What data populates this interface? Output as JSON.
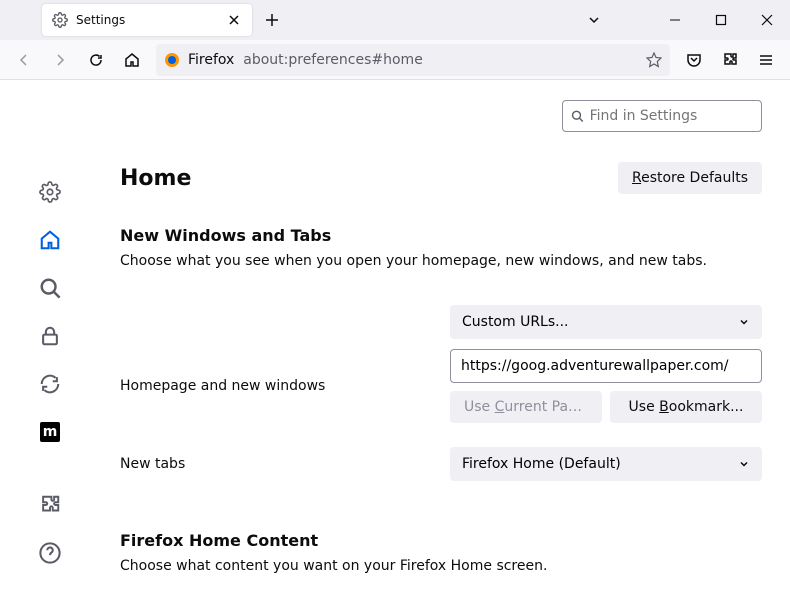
{
  "tab": {
    "title": "Settings"
  },
  "urlbar": {
    "prefix": "Firefox",
    "url": "about:preferences#home"
  },
  "search": {
    "placeholder": "Find in Settings"
  },
  "page": {
    "title": "Home",
    "restore": "Restore Defaults"
  },
  "section": {
    "title": "New Windows and Tabs",
    "desc": "Choose what you see when you open your homepage, new windows, and new tabs."
  },
  "form": {
    "homepage_label": "Homepage and new windows",
    "homepage_select": "Custom URLs...",
    "homepage_value": "https://goog.adventurewallpaper.com/",
    "use_current": "Use Current Pages",
    "use_bookmark": "Use Bookmark...",
    "newtabs_label": "New tabs",
    "newtabs_select": "Firefox Home (Default)"
  },
  "fhc": {
    "title": "Firefox Home Content",
    "desc": "Choose what content you want on your Firefox Home screen."
  }
}
